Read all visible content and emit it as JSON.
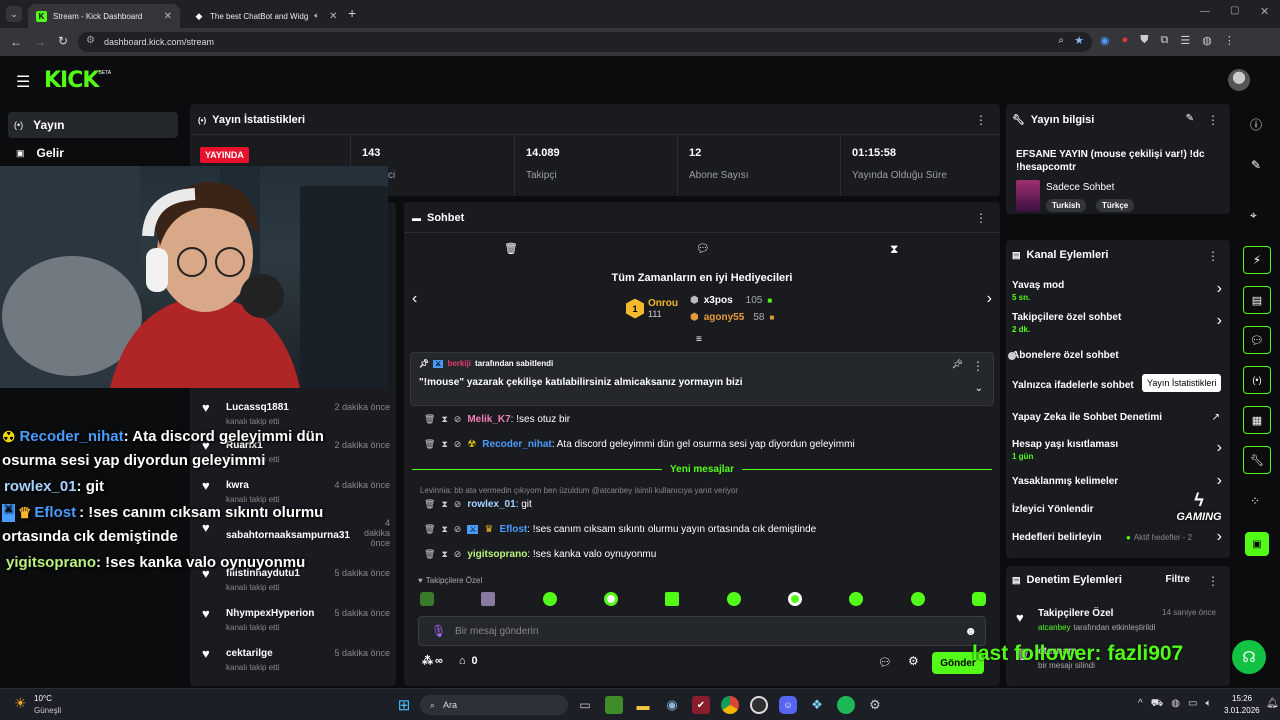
{
  "browser": {
    "tabs": [
      {
        "title": "Stream - Kick Dashboard"
      },
      {
        "title": "The best ChatBot and Widg"
      }
    ],
    "url": "dashboard.kick.com/stream",
    "new_tab": "+"
  },
  "header": {
    "logo": "KICK",
    "beta": "BETA"
  },
  "sidebar": {
    "items": [
      {
        "label": "Yayın"
      },
      {
        "label": "Gelir"
      }
    ]
  },
  "stats": {
    "title": "Yayın İstatistikleri",
    "live_badge": "YAYINDA",
    "viewers": "143",
    "viewers_label_fragment": "ci",
    "followers": "14.089",
    "followers_label": "Takipçi",
    "subs": "12",
    "subs_label": "Abone Sayısı",
    "duration": "01:15:58",
    "duration_label": "Yayında Olduğu Süre"
  },
  "chat": {
    "title": "Sohbet",
    "top_gifters_title": "Tüm Zamanların en iyi Hediyecileri",
    "gifters": [
      {
        "rank": "1",
        "name": "Onrou",
        "count": "111"
      },
      {
        "name": "x3pos",
        "count": "105"
      },
      {
        "name": "agony55",
        "count": "58"
      }
    ],
    "pinned_by": "berkiji",
    "pinned_by_suffix": "tarafından sabitlendi",
    "pinned_text": "\"!mouse\" yazarak çekilişe katılabilirsiniz almicaksanız yormayın bizi",
    "messages_before": [
      {
        "user": "Melik_K7",
        "text": ": !ses otuz bir",
        "color": "#f57fbf"
      },
      {
        "user": "Recoder_nihat",
        "text": ": Ata discord geleyimmi dün gel osurma sesi yap diyordun geleyimmi",
        "color": "#4a9cff"
      }
    ],
    "new_messages_label": "Yeni mesajlar",
    "reply_context": "Levinnia: bb ata vermedin çıkıyom ben üzuldum @atcanbey isimli kullanıcıya yanıt veriyor",
    "messages_after": [
      {
        "user": "rowlex_01",
        "text": ": git",
        "color": "#a5d4ff"
      },
      {
        "user": "Eflost",
        "text": ": !ses canım cıksam sıkıntı olurmu yayın ortasında cık demiştinde",
        "color": "#4a9cff"
      },
      {
        "user": "yigitsoprano",
        "text": ": !ses kanka valo oynuyonmu",
        "color": "#b9f27c"
      }
    ],
    "followers_only": "Takipçilere Özel",
    "input_placeholder": "Bir mesaj gönderin",
    "infinity": "∞",
    "points": "0",
    "send": "Gönder"
  },
  "followers_feed": [
    {
      "name": "Lucassq1881",
      "sub": "kanalı takip etti",
      "time": "2 dakika önce"
    },
    {
      "name": "Ruarix1",
      "sub": "kanalı takip etti",
      "time": "2 dakika önce"
    },
    {
      "name": "kwra",
      "sub": "kanalı takip etti",
      "time": "4 dakika önce"
    },
    {
      "name": "sabahtornaaksampurna31",
      "sub": "kanalı takip etti",
      "time": "4 dakika önce"
    },
    {
      "name": "filistinhaydutu1",
      "sub": "kanalı takip etti",
      "time": "5 dakika önce"
    },
    {
      "name": "NhympexHyperion",
      "sub": "kanalı takip etti",
      "time": "5 dakika önce"
    },
    {
      "name": "cektarilge",
      "sub": "kanalı takip etti",
      "time": "5 dakika önce"
    }
  ],
  "overlay_chat": [
    {
      "user": "Recoder_nihat",
      "text": ": Ata discord geleyimmi dün",
      "color": "#4a9cff"
    },
    {
      "user": "",
      "text": "osurma sesi yap diyordun geleyimmi",
      "color": "#fff"
    },
    {
      "user": "rowlex_01",
      "text": ": git",
      "color": "#a5d4ff"
    },
    {
      "user": "Eflost",
      "text": ": !ses canım cıksam sıkıntı olurmu",
      "color": "#4a9cff"
    },
    {
      "user": "",
      "text": "ortasında cık demiştinde",
      "color": "#fff"
    },
    {
      "user": "yigitsoprano",
      "text": ": !ses kanka valo oynuyonmu",
      "color": "#b9f27c"
    }
  ],
  "stream_info": {
    "title": "Yayın bilgisi",
    "stream_title": "EFSANE YAYIN (mouse çekilişi var!) !dc !hesapcomtr",
    "category": "Sadece Sohbet",
    "tags": [
      "Turkish",
      "Türkçe"
    ]
  },
  "channel_actions": {
    "title": "Kanal Eylemleri",
    "items": [
      {
        "label": "Yavaş mod",
        "sub": "5 sn."
      },
      {
        "label": "Takipçilere özel sohbet",
        "sub": "2 dk."
      },
      {
        "label": "Abonelere özel sohbet",
        "sub": ""
      },
      {
        "label": "Yalnızca ifadelerle sohbet",
        "sub": ""
      },
      {
        "label": "Yapay Zeka ile Sohbet Denetimi",
        "sub": ""
      },
      {
        "label": "Hesap yaşı kısıtlaması",
        "sub": "1 gün"
      },
      {
        "label": "Yasaklanmış kelimeler",
        "sub": ""
      },
      {
        "label": "İzleyici Yönlendir",
        "sub": ""
      },
      {
        "label": "Hedefleri belirleyin",
        "sub": "Aktif hedefler - 2"
      }
    ],
    "tooltip": "Yayın İstatistikleri"
  },
  "moderation": {
    "title": "Denetim Eylemleri",
    "filter": "Filtre",
    "items": [
      {
        "title": "Takipçilere Özel",
        "time": "14 saniye önce",
        "by": "atcanbey",
        "by_suffix": "tarafından etkinleştirildi"
      },
      {
        "title": "eternam",
        "time": "",
        "by": "",
        "by_suffix": "bir mesajı silindi"
      }
    ]
  },
  "overlay_ticker": "last follower: fazli907",
  "gaming_logo": "GAMING",
  "taskbar": {
    "weather_temp": "10°C",
    "weather_desc": "Güneşli",
    "search": "Ara",
    "time": "15:26",
    "date": "3.01.2026"
  },
  "colors": {
    "kick_green": "#53fc18",
    "panel": "#191b1f",
    "bg": "#0b0c0d",
    "live": "#e8112d"
  }
}
